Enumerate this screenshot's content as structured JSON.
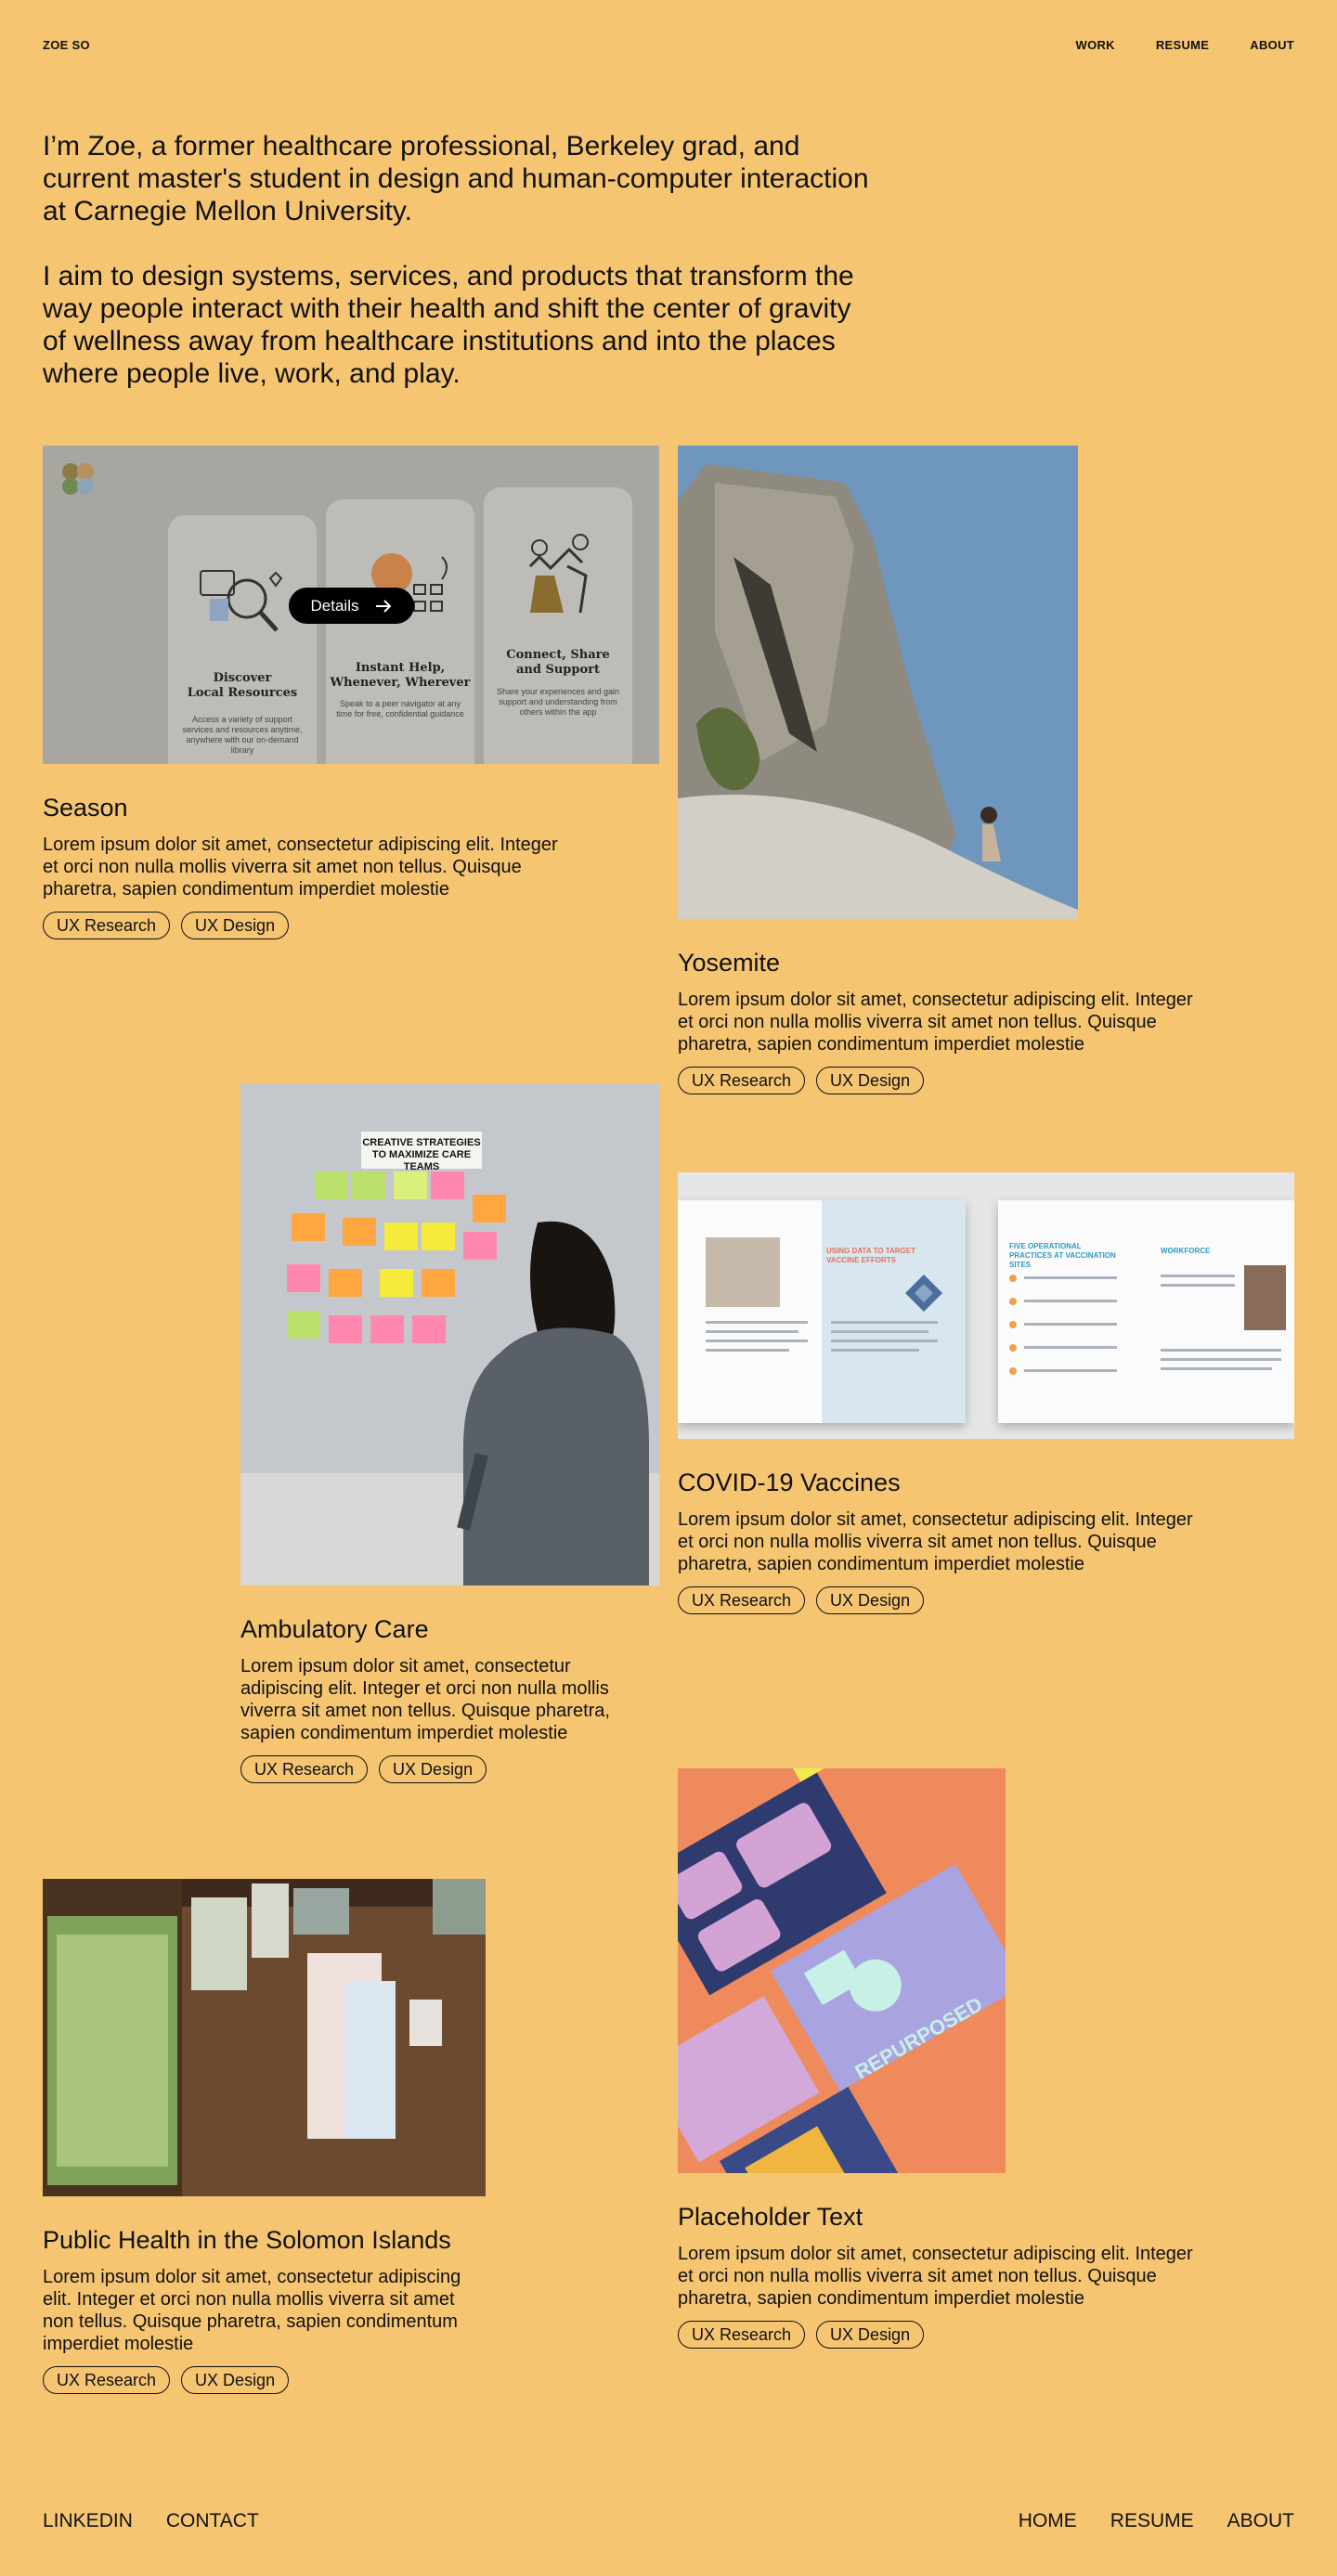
{
  "header": {
    "logo": "ZOE SO",
    "nav": [
      "WORK",
      "RESUME",
      "ABOUT"
    ]
  },
  "intro": {
    "p1": "I’m Zoe, a former healthcare professional, Berkeley grad, and current master's student in design and human-computer interaction at Carnegie Mellon University.",
    "p2": "I aim to design systems, services, and products that transform the way people interact with their health and shift the center of gravity of wellness away from healthcare institutions and into the places where people live, work, and play."
  },
  "season_screens": [
    {
      "title": "Discover\nLocal Resources",
      "sub": "Access a variety of support services and resources anytime, anywhere with our on-demand library"
    },
    {
      "title": "Instant Help,\nWhenever, Wherever",
      "sub": "Speak to a peer navigator at any time for free, confidential guidance"
    },
    {
      "title": "Connect, Share\nand Support",
      "sub": "Share your experiences and gain support and understanding from others within the app"
    }
  ],
  "details_label": "Details",
  "tag_labels": [
    "UX Research",
    "UX Design"
  ],
  "projects": {
    "season": {
      "title": "Season",
      "desc": "Lorem ipsum dolor sit amet, consectetur adipiscing elit. Integer et orci non nulla mollis viverra sit amet non tellus. Quisque pharetra, sapien condimentum imperdiet molestie"
    },
    "yosemite": {
      "title": "Yosemite",
      "desc": "Lorem ipsum dolor sit amet, consectetur adipiscing elit. Integer et orci non nulla mollis viverra sit amet non tellus. Quisque pharetra, sapien condimentum imperdiet molestie"
    },
    "ambulatory": {
      "title": "Ambulatory Care",
      "desc": "Lorem ipsum dolor sit amet, consectetur adipiscing elit. Integer et orci non nulla mollis viverra sit amet non tellus. Quisque pharetra, sapien condimentum imperdiet molestie"
    },
    "covid": {
      "title": "COVID-19 Vaccines",
      "desc": "Lorem ipsum dolor sit amet, consectetur adipiscing elit. Integer et orci non nulla mollis viverra sit amet non tellus. Quisque pharetra, sapien condimentum imperdiet molestie"
    },
    "solomon": {
      "title": "Public Health in the Solomon Islands",
      "desc": "Lorem ipsum dolor sit amet, consectetur adipiscing elit. Integer et orci non nulla mollis viverra sit amet non tellus. Quisque pharetra, sapien condimentum imperdiet molestie"
    },
    "placeholder": {
      "title": "Placeholder Text",
      "desc": "Lorem ipsum dolor sit amet, consectetur adipiscing elit. Integer et orci non nulla mollis viverra sit amet non tellus. Quisque pharetra, sapien condimentum imperdiet molestie"
    }
  },
  "image_text": {
    "poster_heading": "CREATIVE STRATEGIES\nTO MAXIMIZE CARE TEAMS",
    "covid_spread_heading_1": "USING DATA TO TARGET VACCINE EFFORTS",
    "covid_spread_heading_2": "FIVE OPERATIONAL PRACTICES AT VACCINATION SITES",
    "covid_spread_heading_3": "WORKFORCE",
    "repurposed": "REPURPOSED"
  },
  "footer": {
    "left": [
      "LINKEDIN",
      "CONTACT"
    ],
    "right": [
      "HOME",
      "RESUME",
      "ABOUT"
    ]
  },
  "colors": {
    "background": "#F6C572",
    "text": "#111111",
    "pill": "#000000"
  }
}
